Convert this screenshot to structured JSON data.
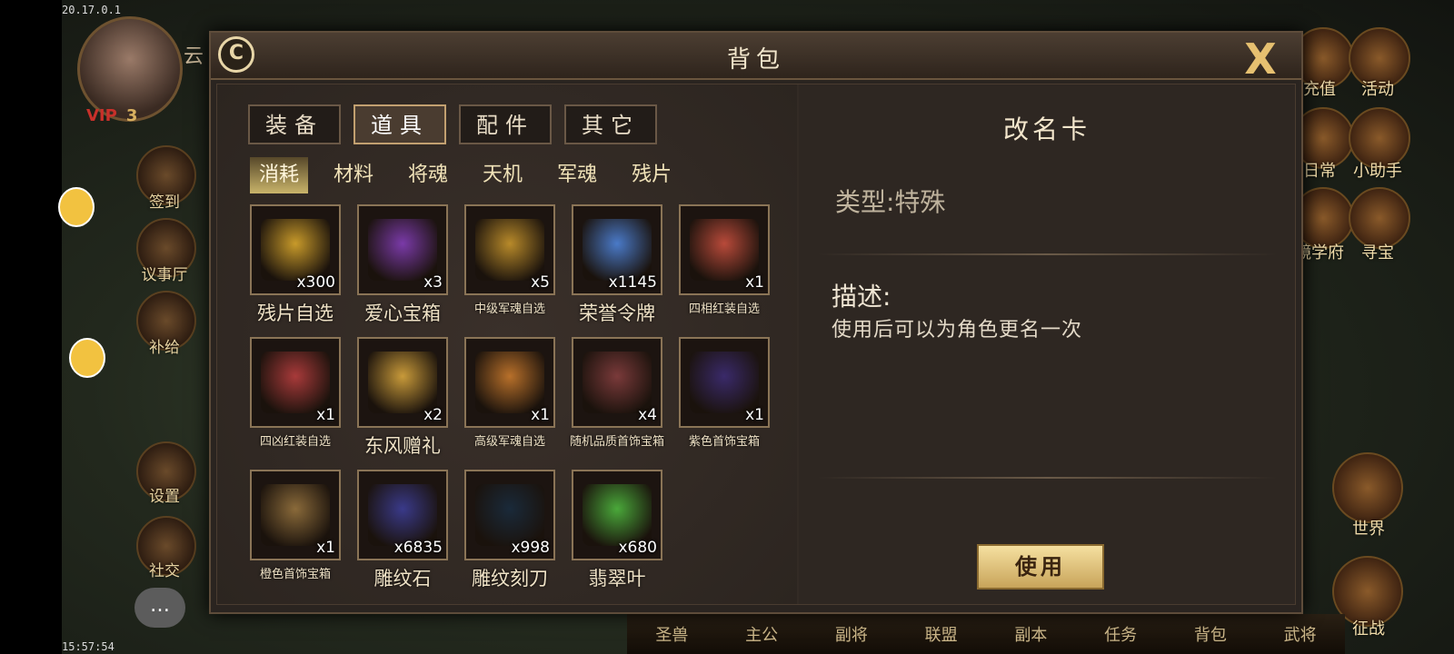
{
  "status": {
    "ip": "20.17.0.1",
    "time": "15:57:54"
  },
  "hud": {
    "vip_label": "VIP",
    "vip_level": "3",
    "player_name_partial": "云",
    "left_menu": [
      "签到",
      "议事厅",
      "补给",
      "设置",
      "社交"
    ],
    "right_menu": [
      "充值",
      "活动",
      "日常",
      "小助手",
      "镜学府",
      "寻宝",
      "世界",
      "征战"
    ],
    "bottom_nav": [
      "圣兽",
      "主公",
      "副将",
      "联盟",
      "副本",
      "任务",
      "背包",
      "武将"
    ]
  },
  "dialog": {
    "title": "背包",
    "close_symbol": "X",
    "refresh_symbol": "C",
    "tabs": [
      "装备",
      "道具",
      "配件",
      "其它"
    ],
    "active_tab": "道具",
    "subtabs": [
      "消耗",
      "材料",
      "将魂",
      "天机",
      "军魂",
      "残片"
    ],
    "active_subtab": "消耗",
    "items": [
      {
        "name": "残片自选",
        "count": "x300",
        "icon": "gold-chest-icon",
        "color": "#c89a2a"
      },
      {
        "name": "爱心宝箱",
        "count": "x3",
        "icon": "heart-chest-icon",
        "color": "#7a3aa8"
      },
      {
        "name": "中级军魂自选",
        "count": "x5",
        "icon": "gold-chest-icon",
        "color": "#b88a2a"
      },
      {
        "name": "荣誉令牌",
        "count": "x1145",
        "icon": "honor-token-icon",
        "color": "#4a7ac8"
      },
      {
        "name": "四相红装自选",
        "count": "x1",
        "icon": "red-chest-icon",
        "color": "#b84a3a"
      },
      {
        "name": "四凶红装自选",
        "count": "x1",
        "icon": "red-chest-icon",
        "color": "#a83a3a"
      },
      {
        "name": "东风赠礼",
        "count": "x2",
        "icon": "gift-box-icon",
        "color": "#c89a3a"
      },
      {
        "name": "高级军魂自选",
        "count": "x1",
        "icon": "red-gold-chest-icon",
        "color": "#b8702a"
      },
      {
        "name": "随机品质首饰宝箱",
        "count": "x4",
        "icon": "jewel-box-icon",
        "color": "#7a3a3a"
      },
      {
        "name": "紫色首饰宝箱",
        "count": "x1",
        "icon": "jewel-box-icon",
        "color": "#3a2a6a"
      },
      {
        "name": "橙色首饰宝箱",
        "count": "x1",
        "icon": "jewel-box-icon",
        "color": "#8a6a3a"
      },
      {
        "name": "雕纹石",
        "count": "x6835",
        "icon": "carving-stone-icon",
        "color": "#3a3a8a"
      },
      {
        "name": "雕纹刻刀",
        "count": "x998",
        "icon": "carving-knife-icon",
        "color": "#1a2a3a"
      },
      {
        "name": "翡翠叶",
        "count": "x680",
        "icon": "jade-leaf-icon",
        "color": "#4aa83a"
      }
    ],
    "detail": {
      "title": "改名卡",
      "type_line": "类型:特殊",
      "desc_label": "描述:",
      "desc_text": "使用后可以为角色更名一次",
      "use_button": "使用"
    }
  }
}
